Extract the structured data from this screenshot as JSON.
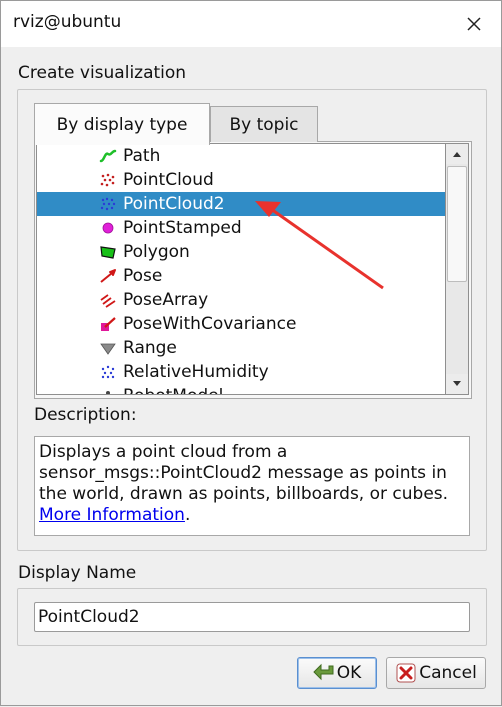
{
  "window": {
    "title": "rviz@ubuntu"
  },
  "group": {
    "title": "Create visualization"
  },
  "tabs": [
    {
      "label": "By display type",
      "active": true
    },
    {
      "label": "By topic",
      "active": false
    }
  ],
  "display_types": [
    {
      "label": "Path",
      "icon": "path-icon",
      "selected": false
    },
    {
      "label": "PointCloud",
      "icon": "pointcloud-icon",
      "selected": false
    },
    {
      "label": "PointCloud2",
      "icon": "pointcloud2-icon",
      "selected": true
    },
    {
      "label": "PointStamped",
      "icon": "pointstamped-icon",
      "selected": false
    },
    {
      "label": "Polygon",
      "icon": "polygon-icon",
      "selected": false
    },
    {
      "label": "Pose",
      "icon": "pose-icon",
      "selected": false
    },
    {
      "label": "PoseArray",
      "icon": "posearray-icon",
      "selected": false
    },
    {
      "label": "PoseWithCovariance",
      "icon": "posewithcovariance-icon",
      "selected": false
    },
    {
      "label": "Range",
      "icon": "range-icon",
      "selected": false
    },
    {
      "label": "RelativeHumidity",
      "icon": "relativehumidity-icon",
      "selected": false
    },
    {
      "label": "RobotModel",
      "icon": "robotmodel-icon",
      "selected": false
    }
  ],
  "description": {
    "label": "Description:",
    "text": "Displays a point cloud from a sensor_msgs::PointCloud2 message as points in the world, drawn as points, billboards, or cubes. ",
    "link": "More Information",
    "trailing": "."
  },
  "display_name": {
    "label": "Display Name",
    "value": "PointCloud2"
  },
  "buttons": {
    "ok": "OK",
    "cancel": "Cancel"
  },
  "colors": {
    "selection": "#308cc6",
    "link": "#0000ee",
    "annotation_arrow": "#e8322d"
  }
}
